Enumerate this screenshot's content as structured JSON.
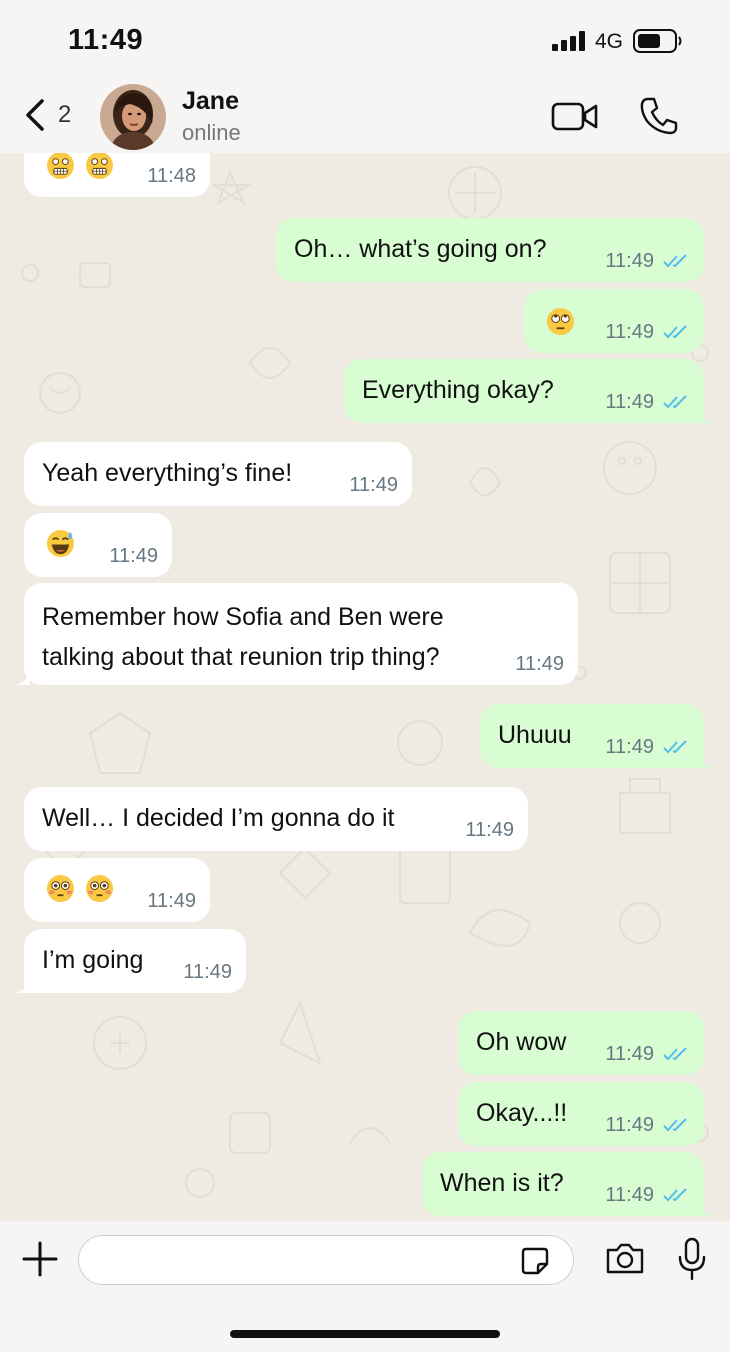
{
  "status_bar": {
    "time": "11:49",
    "network": "4G",
    "icons": [
      "signal-icon",
      "battery-icon"
    ]
  },
  "header": {
    "back_count": "2",
    "contact_name": "Jane",
    "contact_status": "online",
    "icons": [
      "chevron-left-icon",
      "avatar",
      "video-camera-icon",
      "phone-icon"
    ]
  },
  "messages": [
    {
      "dir": "in",
      "emoji": [
        "grimacing-face",
        "grimacing-face"
      ],
      "time": "11:48"
    },
    {
      "dir": "out",
      "text": "Oh… what’s going on?",
      "time": "11:49",
      "status": "read"
    },
    {
      "dir": "out",
      "emoji": [
        "face-with-rolling-eyes"
      ],
      "time": "11:49",
      "status": "read"
    },
    {
      "dir": "out",
      "text": "Everything okay?",
      "time": "11:49",
      "status": "read"
    },
    {
      "dir": "in",
      "text": "Yeah everything’s fine!",
      "time": "11:49"
    },
    {
      "dir": "in",
      "emoji": [
        "grinning-face-with-sweat"
      ],
      "time": "11:49"
    },
    {
      "dir": "in",
      "text_lines": [
        "Remember how Sofia and Ben were",
        "talking about that reunion trip thing?"
      ],
      "time": "11:49"
    },
    {
      "dir": "out",
      "text": "Uhuuu",
      "time": "11:49",
      "status": "read"
    },
    {
      "dir": "in",
      "text": "Well… I decided I’m gonna do it",
      "time": "11:49"
    },
    {
      "dir": "in",
      "emoji": [
        "flushed-face",
        "flushed-face"
      ],
      "time": "11:49"
    },
    {
      "dir": "in",
      "text": "I’m going",
      "time": "11:49"
    },
    {
      "dir": "out",
      "text": "Oh wow",
      "time": "11:49",
      "status": "read"
    },
    {
      "dir": "out",
      "text": "Okay...!!",
      "time": "11:49",
      "status": "read"
    },
    {
      "dir": "out",
      "text": "When is it?",
      "time": "11:49",
      "status": "read"
    }
  ],
  "input_bar": {
    "placeholder": "",
    "icons": [
      "plus-icon",
      "sticker-icon",
      "camera-icon",
      "microphone-icon"
    ]
  },
  "colors": {
    "outgoing_bubble": "#d9fdd3",
    "incoming_bubble": "#ffffff",
    "read_tick": "#53bdeb",
    "wallpaper": "#efeae2"
  }
}
